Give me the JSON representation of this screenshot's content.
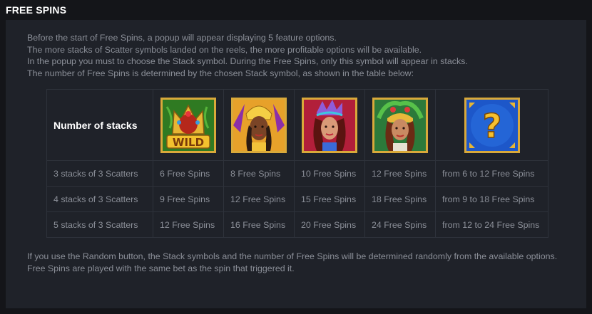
{
  "header": {
    "title": "FREE SPINS"
  },
  "intro": [
    "Before the start of Free Spins, a popup will appear displaying 5 feature options.",
    "The more stacks of Scatter symbols landed on the reels, the more profitable options will be available.",
    "In the popup you must to choose the Stack symbol. During the Free Spins, only this symbol will appear in stacks.",
    "The number of Free Spins is determined by the chosen Stack symbol, as shown in the table below:"
  ],
  "table": {
    "header_label": "Number of stacks",
    "symbols": [
      {
        "icon": "wild-crown-icon",
        "text": "WILD"
      },
      {
        "icon": "yellow-dancer-icon"
      },
      {
        "icon": "red-dancer-icon"
      },
      {
        "icon": "green-dancer-icon"
      },
      {
        "icon": "random-question-icon",
        "text": "?"
      }
    ],
    "rows": [
      [
        "3 stacks of 3 Scatters",
        "6 Free Spins",
        "8 Free Spins",
        "10 Free Spins",
        "12 Free Spins",
        "from 6 to 12 Free Spins"
      ],
      [
        "4 stacks of 3 Scatters",
        "9 Free Spins",
        "12 Free Spins",
        "15 Free Spins",
        "18 Free Spins",
        "from 9 to 18 Free Spins"
      ],
      [
        "5 stacks of 3 Scatters",
        "12 Free Spins",
        "16 Free Spins",
        "20 Free Spins",
        "24 Free Spins",
        "from 12 to 24 Free Spins"
      ]
    ]
  },
  "outro": [
    "If you use the Random button, the Stack symbols and the number of Free Spins will be determined randomly from the available options.",
    "Free Spins are played with the same bet as the spin that triggered it."
  ],
  "colors": {
    "page_background": "#141519",
    "panel_background": "#1f2229",
    "body_text": "#8b8f98",
    "heading_text": "#ffffff",
    "table_border": "#2e323b",
    "symbol_frame": "#d9a93a"
  }
}
